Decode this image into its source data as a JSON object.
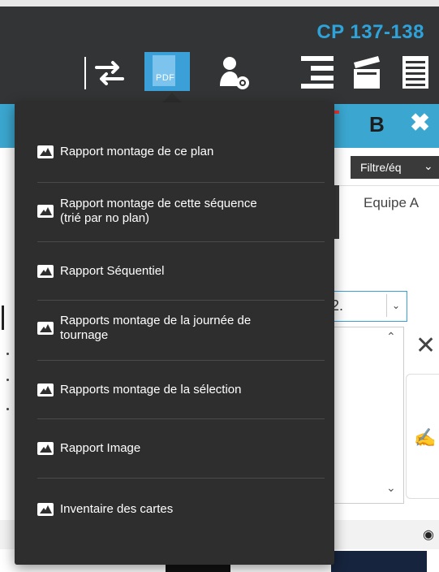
{
  "header": {
    "title": "CP 137-138",
    "pdf_label": "PDF",
    "toolbar_icons": [
      "swap-arrows-icon",
      "pdf-icon",
      "user-settings-icon",
      "align-lines-icon",
      "clapperboard-icon",
      "spreadsheet-icon"
    ]
  },
  "bluebar": {
    "bold_label": "B",
    "close_label": "✖"
  },
  "background": {
    "filter_label": "Filtre/éq",
    "team_label": "Equipe A",
    "select_value": "2."
  },
  "menu": {
    "items": [
      {
        "label": "Rapport montage de ce plan"
      },
      {
        "label_line1": "Rapport montage de cette séquence",
        "label_line2": "(trié par no plan)"
      },
      {
        "label": "Rapport Séquentiel"
      },
      {
        "label_line1": "Rapports montage de la journée de",
        "label_line2": "tournage"
      },
      {
        "label": "Rapports montage de la sélection"
      },
      {
        "label": "Rapport Image"
      },
      {
        "label": "Inventaire des cartes"
      }
    ]
  },
  "colors": {
    "topbar": "#333435",
    "accent": "#3ba6cf",
    "menu_bg": "#2e2e2e",
    "title_blue": "#2ea3da"
  }
}
